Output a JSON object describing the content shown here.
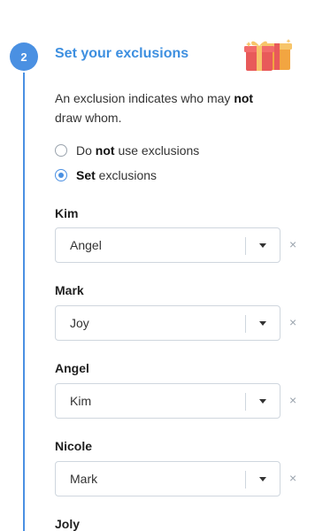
{
  "step": {
    "number": "2",
    "title": "Set your exclusions",
    "icon": "gift-icon"
  },
  "description": {
    "part1": "An exclusion indicates who may ",
    "bold": "not",
    "part2": "draw whom."
  },
  "options": [
    {
      "pre": "Do ",
      "bold": "not",
      "post": " use exclusions",
      "checked": false
    },
    {
      "pre": "",
      "bold": "Set",
      "post": " exclusions",
      "checked": true
    }
  ],
  "exclusions": [
    {
      "person": "Kim",
      "value": "Angel"
    },
    {
      "person": "Mark",
      "value": "Joy"
    },
    {
      "person": "Angel",
      "value": "Kim"
    },
    {
      "person": "Nicole",
      "value": "Mark"
    },
    {
      "person": "Joly",
      "value": ""
    }
  ],
  "clear_symbol": "×",
  "colors": {
    "accent": "#4a90e2",
    "title": "#3d8fe0",
    "border": "#cfd6de"
  }
}
